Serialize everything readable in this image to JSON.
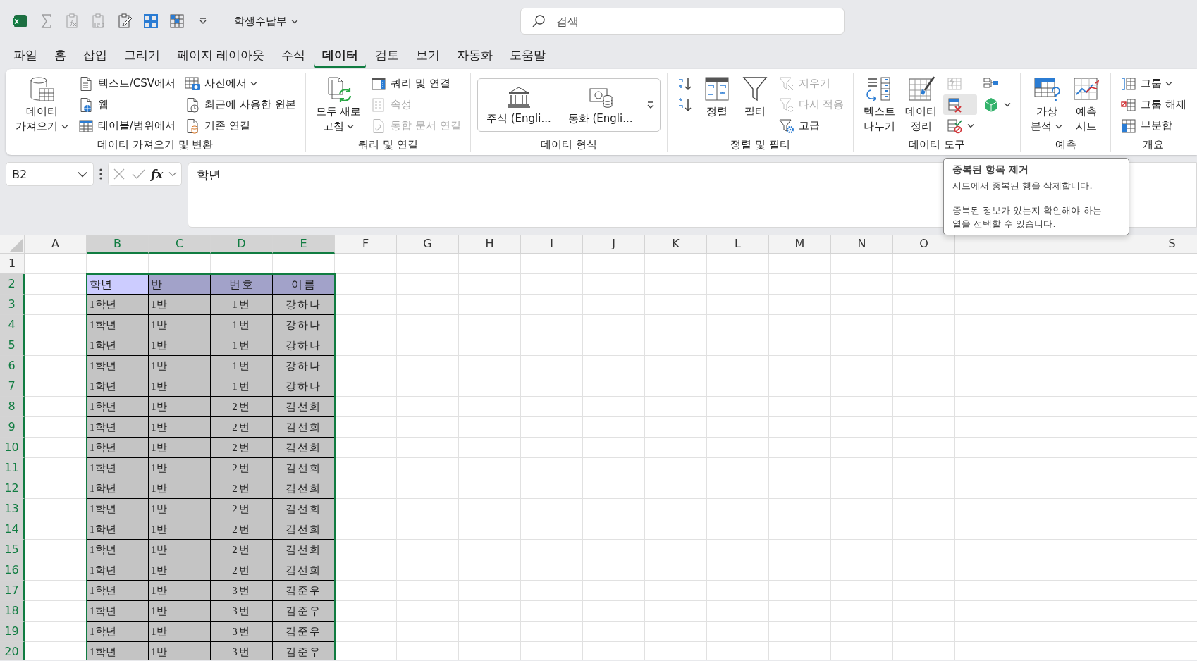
{
  "title_bar": {
    "quick_access": [
      {
        "disabled": false
      },
      {
        "disabled": true
      },
      {
        "disabled": true
      },
      {
        "disabled": true
      },
      {
        "disabled": false
      },
      {
        "disabled": false
      },
      {
        "disabled": false
      }
    ],
    "file_name": "학생수납부",
    "search": {
      "placeholder": "검색"
    }
  },
  "tabs": [
    {
      "label": "파일",
      "selected": false
    },
    {
      "label": "홈",
      "selected": false
    },
    {
      "label": "삽입",
      "selected": false
    },
    {
      "label": "그리기",
      "selected": false
    },
    {
      "label": "페이지 레이아웃",
      "selected": false
    },
    {
      "label": "수식",
      "selected": false
    },
    {
      "label": "데이터",
      "selected": true
    },
    {
      "label": "검토",
      "selected": false
    },
    {
      "label": "보기",
      "selected": false
    },
    {
      "label": "자동화",
      "selected": false
    },
    {
      "label": "도움말",
      "selected": false
    }
  ],
  "ribbon": [
    {
      "label": "데이터 가져오기 및 변환",
      "items": [
        {
          "kind": "large",
          "label": "데이터\n가져오기",
          "dropdown": true,
          "disabled": false
        },
        {
          "kind": "small",
          "label": "텍스트/CSV에서",
          "dropdown": false,
          "disabled": false
        },
        {
          "kind": "small",
          "label": "웹",
          "dropdown": false,
          "disabled": false
        },
        {
          "kind": "small",
          "label": "테이블/범위에서",
          "dropdown": false,
          "disabled": false
        },
        {
          "kind": "small",
          "label": "사진에서",
          "dropdown": true,
          "disabled": false
        },
        {
          "kind": "small",
          "label": "최근에 사용한 원본",
          "dropdown": false,
          "disabled": false
        },
        {
          "kind": "small",
          "label": "기존 연결",
          "dropdown": false,
          "disabled": false
        }
      ]
    },
    {
      "label": "쿼리 및 연결",
      "items": [
        {
          "kind": "large",
          "label": "모두 새로\n고침",
          "dropdown": true,
          "disabled": false
        },
        {
          "kind": "small",
          "label": "쿼리 및 연결",
          "dropdown": false,
          "disabled": false
        },
        {
          "kind": "small",
          "label": "속성",
          "dropdown": false,
          "disabled": true
        },
        {
          "kind": "small",
          "label": "통합 문서 연결",
          "dropdown": false,
          "disabled": true
        }
      ]
    },
    {
      "label": "데이터 형식",
      "items": [
        {
          "kind": "gallery",
          "entries": [
            {
              "label": "주식 (Engli..."
            },
            {
              "label": "통화 (Engli..."
            }
          ]
        }
      ]
    },
    {
      "label": "정렬 및 필터",
      "items": [
        {
          "kind": "icon",
          "hovered": false,
          "dropdown": false
        },
        {
          "kind": "icon",
          "hovered": false,
          "dropdown": false
        },
        {
          "kind": "large",
          "label": "정렬",
          "dropdown": false,
          "disabled": false
        },
        {
          "kind": "large",
          "label": "필터",
          "dropdown": false,
          "disabled": false
        },
        {
          "kind": "small",
          "label": "지우기",
          "dropdown": false,
          "disabled": true
        },
        {
          "kind": "small",
          "label": "다시 적용",
          "dropdown": false,
          "disabled": true
        },
        {
          "kind": "small",
          "label": "고급",
          "dropdown": false,
          "disabled": false
        }
      ]
    },
    {
      "label": "데이터 도구",
      "items": [
        {
          "kind": "large",
          "label": "텍스트\n나누기",
          "dropdown": false,
          "disabled": false
        },
        {
          "kind": "large",
          "label": "데이터\n정리",
          "dropdown": false,
          "disabled": false
        },
        {
          "kind": "icon",
          "hovered": false,
          "dropdown": false
        },
        {
          "kind": "icon",
          "hovered": true,
          "dropdown": false
        },
        {
          "kind": "icon",
          "hovered": false,
          "dropdown": true
        },
        {
          "kind": "icon",
          "hovered": false,
          "dropdown": false
        },
        {
          "kind": "icon",
          "hovered": false,
          "dropdown": true
        }
      ]
    },
    {
      "label": "예측",
      "items": [
        {
          "kind": "large",
          "label": "가상\n분석",
          "dropdown": true,
          "disabled": false
        },
        {
          "kind": "large",
          "label": "예측\n시트",
          "dropdown": false,
          "disabled": false
        }
      ]
    },
    {
      "label": "개요",
      "items": [
        {
          "kind": "small",
          "label": "그룹",
          "dropdown": true,
          "disabled": false
        },
        {
          "kind": "small",
          "label": "그룹 해제",
          "dropdown": false,
          "disabled": false
        },
        {
          "kind": "small",
          "label": "부분합",
          "dropdown": false,
          "disabled": false
        }
      ]
    }
  ],
  "formula_bar": {
    "name_box": "B2",
    "insert_function": "fx",
    "formula": "학년"
  },
  "tooltip": {
    "title": "중복된 항목 제거",
    "paragraphs": [
      "시트에서 중복된 행을 삭제합니다.",
      "중복된 정보가 있는지 확인해야 하는 열을 선택할 수 있습니다."
    ]
  },
  "sheet": {
    "columns": [
      {
        "label": "A",
        "selected": false
      },
      {
        "label": "B",
        "selected": true
      },
      {
        "label": "C",
        "selected": true
      },
      {
        "label": "D",
        "selected": true
      },
      {
        "label": "E",
        "selected": true
      },
      {
        "label": "F",
        "selected": false
      },
      {
        "label": "G",
        "selected": false
      },
      {
        "label": "H",
        "selected": false
      },
      {
        "label": "I",
        "selected": false
      },
      {
        "label": "J",
        "selected": false
      },
      {
        "label": "K",
        "selected": false
      },
      {
        "label": "L",
        "selected": false
      },
      {
        "label": "M",
        "selected": false
      },
      {
        "label": "N",
        "selected": false
      },
      {
        "label": "O",
        "selected": false
      },
      {
        "selected": false
      },
      {
        "selected": false
      },
      {
        "selected": false
      },
      {
        "label": "S",
        "selected": false
      }
    ],
    "rows": [
      {
        "label": "1",
        "selected": false
      },
      {
        "label": "2",
        "selected": true,
        "kind": "header",
        "cells": [
          {
            "text": "학년",
            "active": true
          },
          {
            "text": "반",
            "active": false
          },
          {
            "text": "번호",
            "active": false
          },
          {
            "text": "이름",
            "active": false
          }
        ]
      },
      {
        "label": "3",
        "selected": true,
        "kind": "data",
        "cells": [
          {
            "text": "1학년",
            "active": false
          },
          {
            "text": "1반",
            "active": false
          },
          {
            "text": "1번",
            "active": false
          },
          {
            "text": "강하나",
            "active": false
          }
        ]
      },
      {
        "label": "4",
        "selected": true,
        "kind": "data",
        "cells": [
          {
            "text": "1학년",
            "active": false
          },
          {
            "text": "1반",
            "active": false
          },
          {
            "text": "1번",
            "active": false
          },
          {
            "text": "강하나",
            "active": false
          }
        ]
      },
      {
        "label": "5",
        "selected": true,
        "kind": "data",
        "cells": [
          {
            "text": "1학년",
            "active": false
          },
          {
            "text": "1반",
            "active": false
          },
          {
            "text": "1번",
            "active": false
          },
          {
            "text": "강하나",
            "active": false
          }
        ]
      },
      {
        "label": "6",
        "selected": true,
        "kind": "data",
        "cells": [
          {
            "text": "1학년",
            "active": false
          },
          {
            "text": "1반",
            "active": false
          },
          {
            "text": "1번",
            "active": false
          },
          {
            "text": "강하나",
            "active": false
          }
        ]
      },
      {
        "label": "7",
        "selected": true,
        "kind": "data",
        "cells": [
          {
            "text": "1학년",
            "active": false
          },
          {
            "text": "1반",
            "active": false
          },
          {
            "text": "1번",
            "active": false
          },
          {
            "text": "강하나",
            "active": false
          }
        ]
      },
      {
        "label": "8",
        "selected": true,
        "kind": "data",
        "cells": [
          {
            "text": "1학년",
            "active": false
          },
          {
            "text": "1반",
            "active": false
          },
          {
            "text": "2번",
            "active": false
          },
          {
            "text": "김선희",
            "active": false
          }
        ]
      },
      {
        "label": "9",
        "selected": true,
        "kind": "data",
        "cells": [
          {
            "text": "1학년",
            "active": false
          },
          {
            "text": "1반",
            "active": false
          },
          {
            "text": "2번",
            "active": false
          },
          {
            "text": "김선희",
            "active": false
          }
        ]
      },
      {
        "label": "10",
        "selected": true,
        "kind": "data",
        "cells": [
          {
            "text": "1학년",
            "active": false
          },
          {
            "text": "1반",
            "active": false
          },
          {
            "text": "2번",
            "active": false
          },
          {
            "text": "김선희",
            "active": false
          }
        ]
      },
      {
        "label": "11",
        "selected": true,
        "kind": "data",
        "cells": [
          {
            "text": "1학년",
            "active": false
          },
          {
            "text": "1반",
            "active": false
          },
          {
            "text": "2번",
            "active": false
          },
          {
            "text": "김선희",
            "active": false
          }
        ]
      },
      {
        "label": "12",
        "selected": true,
        "kind": "data",
        "cells": [
          {
            "text": "1학년",
            "active": false
          },
          {
            "text": "1반",
            "active": false
          },
          {
            "text": "2번",
            "active": false
          },
          {
            "text": "김선희",
            "active": false
          }
        ]
      },
      {
        "label": "13",
        "selected": true,
        "kind": "data",
        "cells": [
          {
            "text": "1학년",
            "active": false
          },
          {
            "text": "1반",
            "active": false
          },
          {
            "text": "2번",
            "active": false
          },
          {
            "text": "김선희",
            "active": false
          }
        ]
      },
      {
        "label": "14",
        "selected": true,
        "kind": "data",
        "cells": [
          {
            "text": "1학년",
            "active": false
          },
          {
            "text": "1반",
            "active": false
          },
          {
            "text": "2번",
            "active": false
          },
          {
            "text": "김선희",
            "active": false
          }
        ]
      },
      {
        "label": "15",
        "selected": true,
        "kind": "data",
        "cells": [
          {
            "text": "1학년",
            "active": false
          },
          {
            "text": "1반",
            "active": false
          },
          {
            "text": "2번",
            "active": false
          },
          {
            "text": "김선희",
            "active": false
          }
        ]
      },
      {
        "label": "16",
        "selected": true,
        "kind": "data",
        "cells": [
          {
            "text": "1학년",
            "active": false
          },
          {
            "text": "1반",
            "active": false
          },
          {
            "text": "2번",
            "active": false
          },
          {
            "text": "김선희",
            "active": false
          }
        ]
      },
      {
        "label": "17",
        "selected": true,
        "kind": "data",
        "cells": [
          {
            "text": "1학년",
            "active": false
          },
          {
            "text": "1반",
            "active": false
          },
          {
            "text": "3번",
            "active": false
          },
          {
            "text": "김준우",
            "active": false
          }
        ]
      },
      {
        "label": "18",
        "selected": true,
        "kind": "data",
        "cells": [
          {
            "text": "1학년",
            "active": false
          },
          {
            "text": "1반",
            "active": false
          },
          {
            "text": "3번",
            "active": false
          },
          {
            "text": "김준우",
            "active": false
          }
        ]
      },
      {
        "label": "19",
        "selected": true,
        "kind": "data",
        "cells": [
          {
            "text": "1학년",
            "active": false
          },
          {
            "text": "1반",
            "active": false
          },
          {
            "text": "3번",
            "active": false
          },
          {
            "text": "김준우",
            "active": false
          }
        ]
      },
      {
        "label": "20",
        "selected": true,
        "kind": "data",
        "cells": [
          {
            "text": "1학년",
            "active": false
          },
          {
            "text": "1반",
            "active": false
          },
          {
            "text": "3번",
            "active": false
          },
          {
            "text": "김준우",
            "active": false
          }
        ]
      }
    ]
  }
}
